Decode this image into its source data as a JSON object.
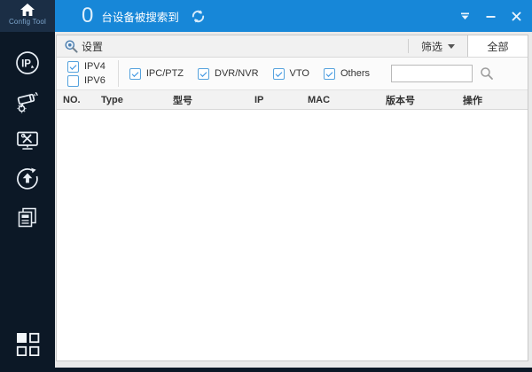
{
  "window": {
    "title": "Config Tool"
  },
  "header": {
    "device_count": "0",
    "device_count_label": "台设备被搜索到"
  },
  "toolbar": {
    "settings_label": "设置",
    "filter_label": "筛选",
    "all_label": "全部"
  },
  "filters": {
    "ip_versions": [
      {
        "label": "IPV4",
        "checked": true
      },
      {
        "label": "IPV6",
        "checked": false
      }
    ],
    "device_types": [
      {
        "label": "IPC/PTZ",
        "checked": true
      },
      {
        "label": "DVR/NVR",
        "checked": true
      },
      {
        "label": "VTO",
        "checked": true
      },
      {
        "label": "Others",
        "checked": true
      }
    ],
    "search_value": ""
  },
  "table": {
    "columns": [
      "NO.",
      "Type",
      "型号",
      "IP",
      "MAC",
      "版本号",
      "操作"
    ],
    "rows": []
  },
  "icons": {
    "logo": "home-icon",
    "refresh": "refresh-icon",
    "pin": "pin-icon",
    "minimize": "minimize-icon",
    "close": "close-icon",
    "settings": "magnifier-gear-icon",
    "search": "magnifier-icon",
    "sidebar": [
      "ip-edit-icon",
      "camera-config-icon",
      "system-tools-icon",
      "upgrade-icon",
      "document-template-icon"
    ],
    "apps": "apps-grid-icon"
  },
  "colors": {
    "accent": "#1787d8",
    "sidebar_bg": "#0c1826",
    "logo_bg": "#1b2e45",
    "checkbox_border": "#55a2dd"
  }
}
